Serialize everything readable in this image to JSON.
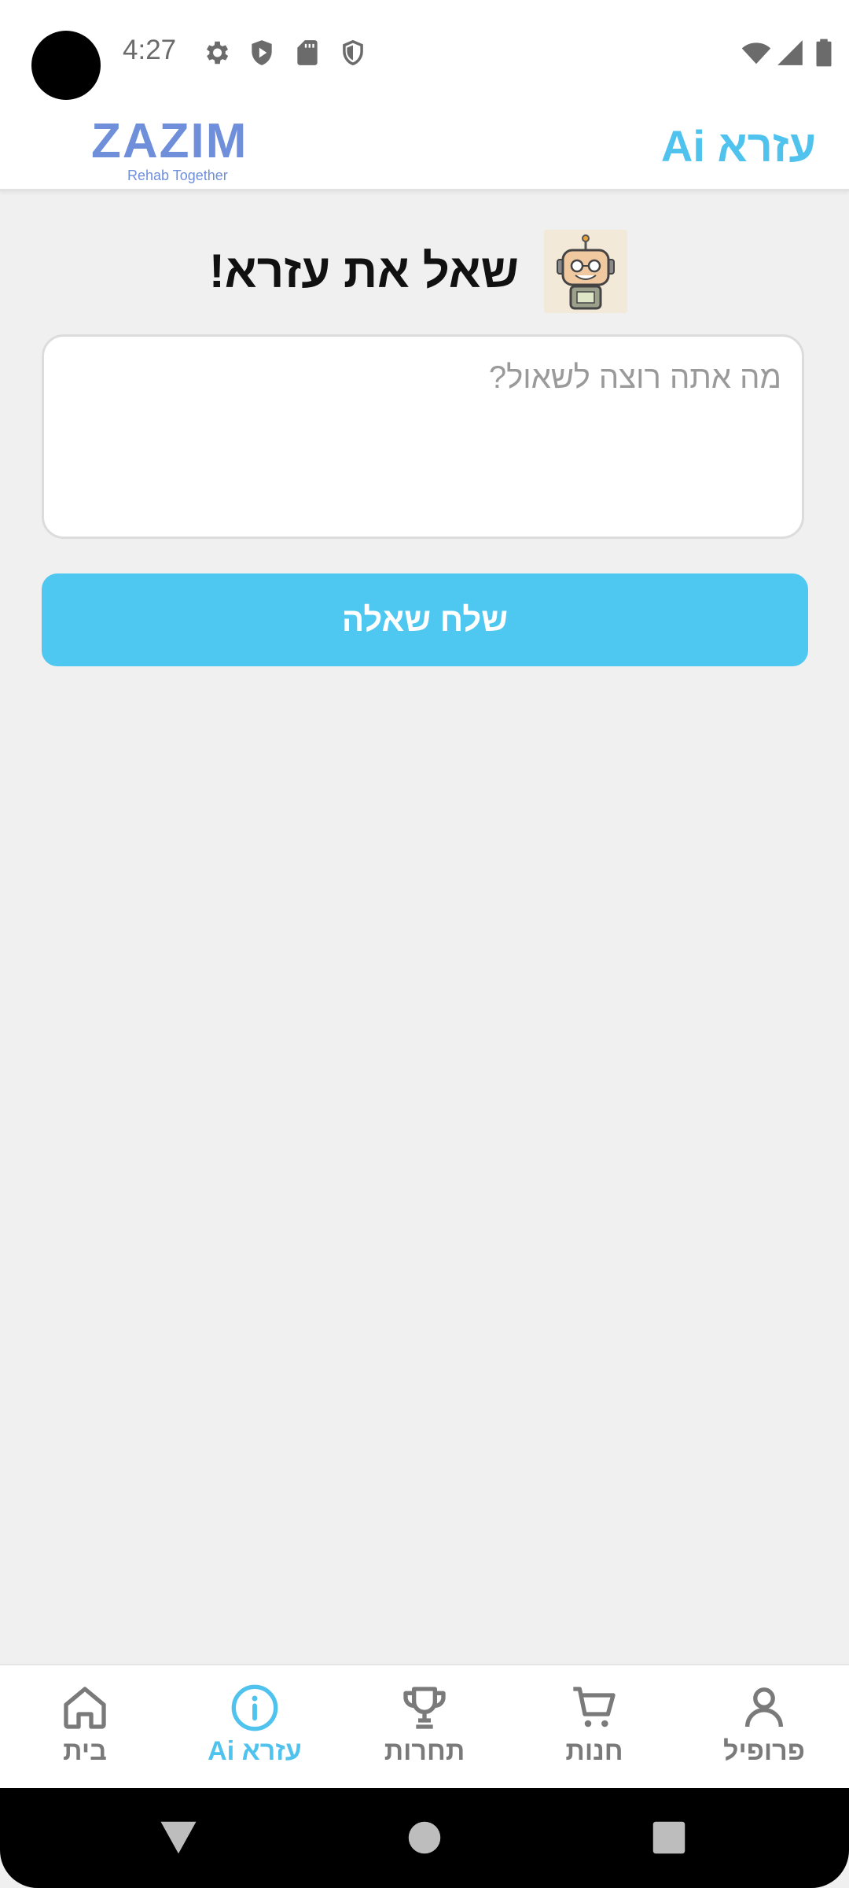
{
  "status_bar": {
    "time": "4:27"
  },
  "header": {
    "logo_text": "ZAZIM",
    "logo_tagline": "Rehab Together",
    "title": "עזרא Ai"
  },
  "ask": {
    "title": "שאל את עזרא!",
    "placeholder": "מה אתה רוצה לשאול?",
    "send_label": "שלח שאלה"
  },
  "nav": {
    "items": [
      {
        "label": "בית",
        "icon": "home-icon"
      },
      {
        "label": "עזרא Ai",
        "icon": "info-icon",
        "active": true
      },
      {
        "label": "תחרות",
        "icon": "trophy-icon"
      },
      {
        "label": "חנות",
        "icon": "cart-icon"
      },
      {
        "label": "פרופיל",
        "icon": "person-icon"
      }
    ]
  },
  "colors": {
    "accent": "#4fc3ee",
    "logo": "#6f8fdb",
    "background": "#f0f0f0",
    "inactive": "#7a7a7a"
  }
}
